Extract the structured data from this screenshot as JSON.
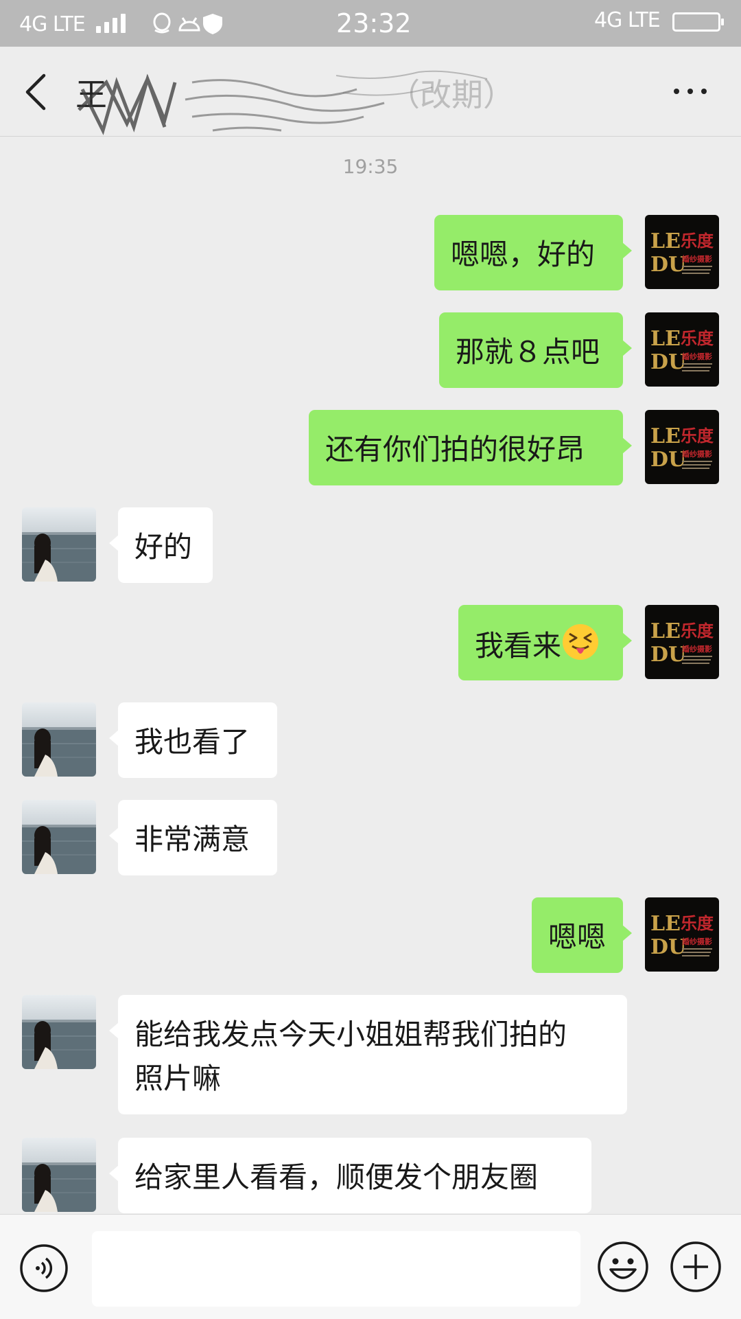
{
  "status_bar": {
    "network_left": "4G LTE",
    "time": "23:32",
    "network_right": "4G LTE"
  },
  "header": {
    "title_visible": "王",
    "title_suffix": "（改期）"
  },
  "timestamp": "19:35",
  "messages": [
    {
      "side": "out",
      "text": "嗯嗯，好的"
    },
    {
      "side": "out",
      "text": "那就８点吧"
    },
    {
      "side": "out",
      "text": "还有你们拍的很好昂"
    },
    {
      "side": "in",
      "text": "好的"
    },
    {
      "side": "out",
      "text": "我看来",
      "emoji": "squinting-tongue-face"
    },
    {
      "side": "in",
      "text": "我也看了"
    },
    {
      "side": "in",
      "text": "非常满意"
    },
    {
      "side": "out",
      "text": "嗯嗯"
    },
    {
      "side": "in",
      "text": "能给我发点今天小姐姐帮我们拍的\n照片嘛"
    },
    {
      "side": "in",
      "text": "给家里人看看，顺便发个朋友圈"
    }
  ],
  "logo": {
    "line1_left": "LE",
    "line1_right": "乐度",
    "line2_left": "DU",
    "line2_right": "婚纱摄影",
    "colors": {
      "gold": "#c9a24a",
      "red": "#c2272d",
      "bg": "#0b0a08"
    }
  },
  "colors": {
    "outgoing_bubble": "#95ec69",
    "incoming_bubble": "#ffffff",
    "background": "#ededed"
  }
}
